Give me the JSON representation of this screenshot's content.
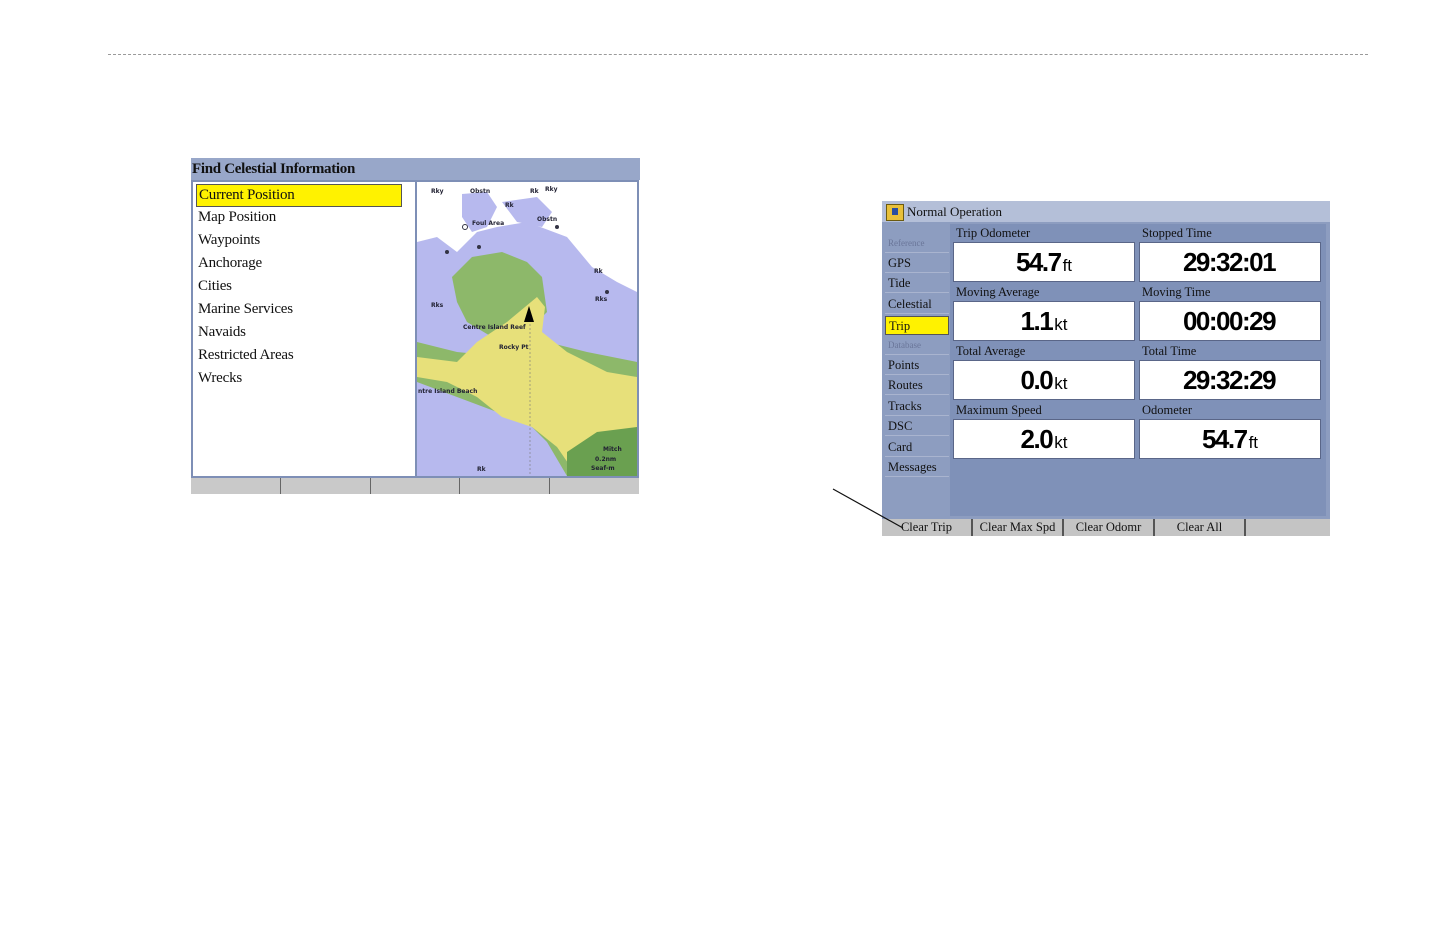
{
  "celestial_screen": {
    "title": "Find Celestial Information",
    "items": [
      {
        "label": "Current Position",
        "selected": true
      },
      {
        "label": "Map Position"
      },
      {
        "label": "Waypoints"
      },
      {
        "label": "Anchorage"
      },
      {
        "label": "Cities"
      },
      {
        "label": "Marine Services"
      },
      {
        "label": "Navaids"
      },
      {
        "label": "Restricted Areas"
      },
      {
        "label": "Wrecks"
      }
    ],
    "map": {
      "labels": [
        "Rky",
        "Obstn",
        "Rk",
        "Rky",
        "Rk",
        "Foul Area",
        "Obstn",
        "Rk",
        "Rks",
        "Rks",
        "Centre Island Reef",
        "Rocky Pt",
        "ntre Island Beach",
        "Rk",
        "Mitch",
        "0.2nm",
        "Seaf-m"
      ],
      "scale": "0.2nm"
    },
    "softkeys": [
      "",
      "",
      "",
      "",
      ""
    ]
  },
  "normal_screen": {
    "header_icon": "chart-folder-icon",
    "title": "Normal Operation",
    "tabs": [
      {
        "label": "Reference",
        "group": true
      },
      {
        "label": "GPS"
      },
      {
        "label": "Tide"
      },
      {
        "label": "Celestial"
      },
      {
        "label": "Trip",
        "selected": true
      },
      {
        "label": "Database",
        "group": true
      },
      {
        "label": "Points"
      },
      {
        "label": "Routes"
      },
      {
        "label": "Tracks"
      },
      {
        "label": "DSC"
      },
      {
        "label": "Card"
      },
      {
        "label": "Messages"
      }
    ],
    "fields": [
      {
        "label": "Trip Odometer",
        "value": "54.7",
        "unit": "ft"
      },
      {
        "label": "Stopped Time",
        "value": "29:32:01",
        "unit": ""
      },
      {
        "label": "Moving Average",
        "value": "1.1",
        "unit": "kt"
      },
      {
        "label": "Moving Time",
        "value": "00:00:29",
        "unit": ""
      },
      {
        "label": "Total Average",
        "value": "0.0",
        "unit": "kt"
      },
      {
        "label": "Total Time",
        "value": "29:32:29",
        "unit": ""
      },
      {
        "label": "Maximum Speed",
        "value": "2.0",
        "unit": "kt"
      },
      {
        "label": "Odometer",
        "value": "54.7",
        "unit": "ft"
      }
    ],
    "softkeys": [
      "Clear Trip",
      "Clear Max Spd",
      "Clear Odomr",
      "Clear All",
      ""
    ]
  },
  "colors": {
    "selection": "#fff200",
    "panel": "#8d9dc0",
    "water": "#b7b9ee",
    "land": "#e7e07a",
    "shallows": "#8db86a"
  }
}
